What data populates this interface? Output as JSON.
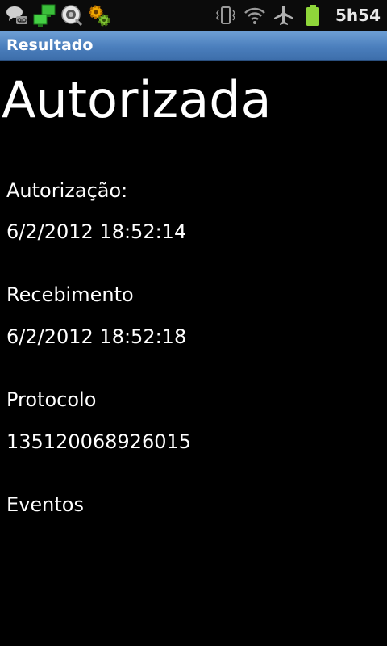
{
  "status_bar": {
    "left_icons": [
      "voicemail-chat-icon",
      "network-sync-icon",
      "usb-debug-icon",
      "settings-gear-icon"
    ],
    "right_icons": [
      "vibrate-icon",
      "wifi-icon",
      "airplane-mode-icon",
      "battery-icon"
    ],
    "time": "5h54"
  },
  "title_bar": {
    "title": "Resultado"
  },
  "result": {
    "status": "Autorizada",
    "autorizacao_label": "Autorização:",
    "autorizacao_value": "6/2/2012 18:52:14",
    "recebimento_label": "Recebimento",
    "recebimento_value": "6/2/2012 18:52:18",
    "protocolo_label": "Protocolo",
    "protocolo_value": "135120068926015",
    "eventos_label": "Eventos"
  },
  "colors": {
    "background": "#000000",
    "title_bar": "#4b7fbd",
    "battery": "#8fd63a"
  }
}
